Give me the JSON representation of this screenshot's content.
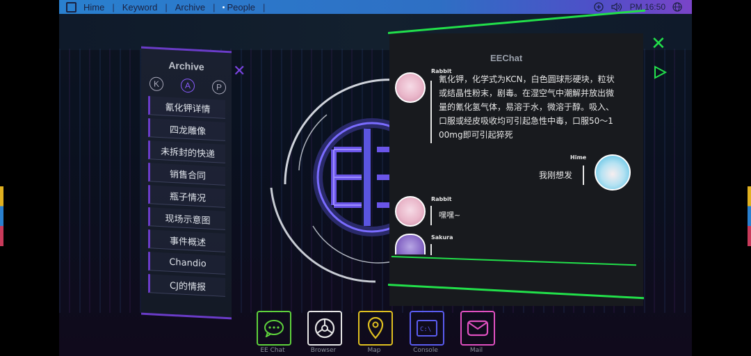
{
  "header": {
    "items": [
      "Hime",
      "Keyword",
      "Archive",
      "People"
    ],
    "time": "PM 16:50"
  },
  "archive": {
    "title": "Archive",
    "tabs": [
      "K",
      "A",
      "P"
    ],
    "active_tab": "A",
    "items": [
      "氰化钾详情",
      "四龙雕像",
      "未拆封的快递",
      "销售合同",
      "瓶子情况",
      "现场示意图",
      "事件概述",
      "Chandio",
      "CJ的情报"
    ]
  },
  "chat": {
    "title": "EEChat",
    "messages": [
      {
        "sender": "Rabbit",
        "lines": [
          "氰化钾，化学式为KCN，白色圆球形硬块，粒状",
          "或结晶性粉末，剧毒。在湿空气中潮解并放出微",
          "量的氰化氢气体，易溶于水，微溶于醇。吸入、",
          "口服或经皮吸收均可引起急性中毒，口服50～1",
          "00mg即可引起猝死"
        ]
      },
      {
        "sender": "Hime",
        "lines": [
          "我刚想发"
        ]
      },
      {
        "sender": "Rabbit",
        "lines": [
          "嘿嘿~"
        ]
      },
      {
        "sender": "Sakura",
        "lines": [
          ""
        ]
      }
    ]
  },
  "dock": [
    {
      "label": "EE Chat",
      "color": "#5fd23c"
    },
    {
      "label": "Browser",
      "color": "#e6e6e6"
    },
    {
      "label": "Map",
      "color": "#e0c020"
    },
    {
      "label": "Console",
      "color": "#5a5cf0"
    },
    {
      "label": "Mail",
      "color": "#e050c0"
    }
  ],
  "colors": {
    "accent_green": "#22e04a",
    "accent_purple": "#6a3cc8"
  }
}
